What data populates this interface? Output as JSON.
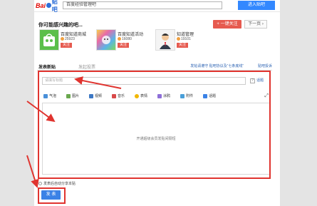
{
  "header": {
    "logo_text_1": "Bai",
    "logo_text_2": "贴吧",
    "search_value": "百度经验管理吧",
    "enter_button": "进入贴吧"
  },
  "interest": {
    "title": "你可能感兴趣的吧...",
    "follow_all": "+ 一键关注",
    "next_page": "下一页 ›",
    "cards": [
      {
        "name": "百度知道商城",
        "count": "25923",
        "follow": "关注"
      },
      {
        "name": "百度知道活动",
        "count": "16080",
        "follow": "关注"
      },
      {
        "name": "知道管理",
        "count": "19101",
        "follow": "关注"
      }
    ]
  },
  "post": {
    "tab_active": "发表新贴",
    "tab_inactive": "发起投票",
    "link_rules": "发帖请遵守 贴吧协议及“七条底线”",
    "link_complaint": "贴吧投诉",
    "title_placeholder": "请填写标题",
    "title_help": "话题",
    "title_help_icon": "?",
    "fullscreen_icon": "⤢",
    "toolbar": [
      {
        "label": "气泡",
        "color": "#4a90d9"
      },
      {
        "label": "图片",
        "color": "#6aa84f"
      },
      {
        "label": "视频",
        "color": "#3d78c4"
      },
      {
        "label": "音乐",
        "color": "#d94a4a"
      },
      {
        "label": "表情",
        "color": "#f1b700"
      },
      {
        "label": "涂鸦",
        "color": "#8e6fd8"
      },
      {
        "label": "附件",
        "color": "#4a9fd9"
      },
      {
        "label": "话题",
        "color": "#3b82e6"
      }
    ],
    "editor_placeholder": "开通超级会员发贴间隔短",
    "auto_share": "发表后自动分享本贴",
    "publish_button": "发 表"
  }
}
